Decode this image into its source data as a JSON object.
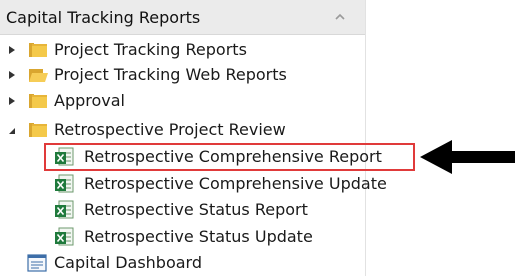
{
  "panel": {
    "title": "Capital Tracking Reports",
    "collapse_icon": "chevron-up-icon"
  },
  "tree": [
    {
      "label": "Project Tracking Reports",
      "icon": "folder-icon",
      "expanded": false
    },
    {
      "label": "Project Tracking Web Reports",
      "icon": "folder-open-icon",
      "expanded": false
    },
    {
      "label": "Approval",
      "icon": "folder-icon",
      "expanded": false
    },
    {
      "label": "Retrospective Project Review",
      "icon": "folder-icon",
      "expanded": true,
      "children": [
        {
          "label": "Retrospective Comprehensive Report",
          "icon": "excel-report-icon",
          "highlighted": true
        },
        {
          "label": "Retrospective Comprehensive Update",
          "icon": "excel-report-icon"
        },
        {
          "label": "Retrospective Status Report",
          "icon": "excel-report-icon"
        },
        {
          "label": "Retrospective Status Update",
          "icon": "excel-report-icon"
        }
      ]
    },
    {
      "label": "Capital Dashboard",
      "icon": "dashboard-icon"
    }
  ],
  "annotation": {
    "highlight_color": "#e03a3a",
    "pointer": "black-arrow-left"
  }
}
